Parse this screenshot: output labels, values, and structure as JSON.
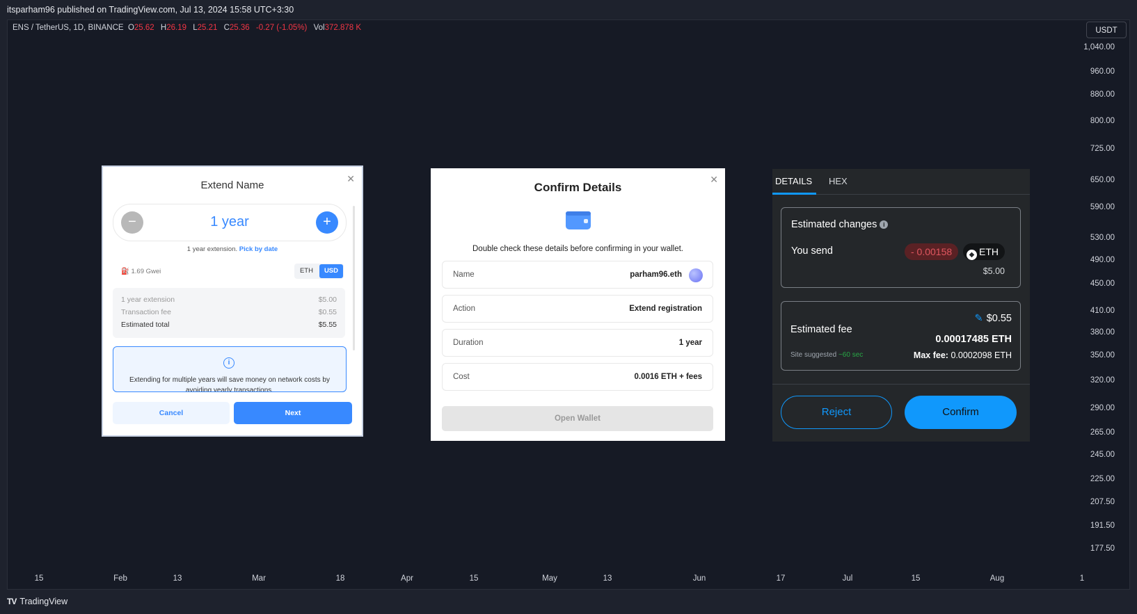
{
  "header": {
    "published": "itsparham96 published on TradingView.com, Jul 13, 2024 15:58 UTC+3:30"
  },
  "ohlc": {
    "symbol": "ENS / TetherUS, 1D, BINANCE",
    "o_label": "O",
    "o": "25.62",
    "h_label": "H",
    "h": "26.19",
    "l_label": "L",
    "l": "25.21",
    "c_label": "C",
    "c": "25.36",
    "change": "-0.27 (-1.05%)",
    "vol_label": "Vol",
    "vol": "372.878 K"
  },
  "currency_button": "USDT",
  "y_axis": [
    "1,040.00",
    "960.00",
    "880.00",
    "800.00",
    "725.00",
    "650.00",
    "590.00",
    "530.00",
    "490.00",
    "450.00",
    "410.00",
    "380.00",
    "350.00",
    "320.00",
    "290.00",
    "265.00",
    "245.00",
    "225.00",
    "207.50",
    "191.50",
    "177.50"
  ],
  "x_axis": [
    "15",
    "Feb",
    "13",
    "Mar",
    "18",
    "Apr",
    "15",
    "May",
    "13",
    "Jun",
    "17",
    "Jul",
    "15",
    "Aug",
    "1"
  ],
  "footer": {
    "brand": "TradingView",
    "brand_mark": "TV"
  },
  "extend_panel": {
    "title": "Extend Name",
    "duration": "1 year",
    "minus": "−",
    "plus": "+",
    "extension_text": "1 year extension.",
    "pick_by_date": "Pick by date",
    "gwei": "1.69 Gwei",
    "gas_icon": "fuel-pump-icon",
    "currency_eth": "ETH",
    "currency_usd": "USD",
    "rows": [
      {
        "label": "1 year extension",
        "value": "$5.00"
      },
      {
        "label": "Transaction fee",
        "value": "$0.55"
      },
      {
        "label": "Estimated total",
        "value": "$5.55"
      }
    ],
    "info_text": "Extending for multiple years will save money on network costs by avoiding yearly transactions.",
    "cancel": "Cancel",
    "next": "Next"
  },
  "confirm_panel": {
    "title": "Confirm Details",
    "subtitle": "Double check these details before confirming in your wallet.",
    "rows": [
      {
        "label": "Name",
        "value": "parham96.eth"
      },
      {
        "label": "Action",
        "value": "Extend registration"
      },
      {
        "label": "Duration",
        "value": "1 year"
      },
      {
        "label": "Cost",
        "value": "0.0016 ETH + fees"
      }
    ],
    "open_wallet": "Open Wallet",
    "wallet_color": "#5298ff"
  },
  "wallet_panel": {
    "tabs": [
      "DETAILS",
      "HEX"
    ],
    "estimated_changes": "Estimated changes",
    "you_send": "You send",
    "send_amount": "- 0.00158",
    "send_token": "ETH",
    "send_usd": "$5.00",
    "fee_usd": "$0.55",
    "estimated_fee": "Estimated fee",
    "fee_eth": "0.00017485 ETH",
    "site_suggested": "Site suggested",
    "time": "~60 sec",
    "max_fee_label": "Max fee:",
    "max_fee": "0.0002098 ETH",
    "reject": "Reject",
    "confirm": "Confirm",
    "accent": "#1098fc"
  }
}
